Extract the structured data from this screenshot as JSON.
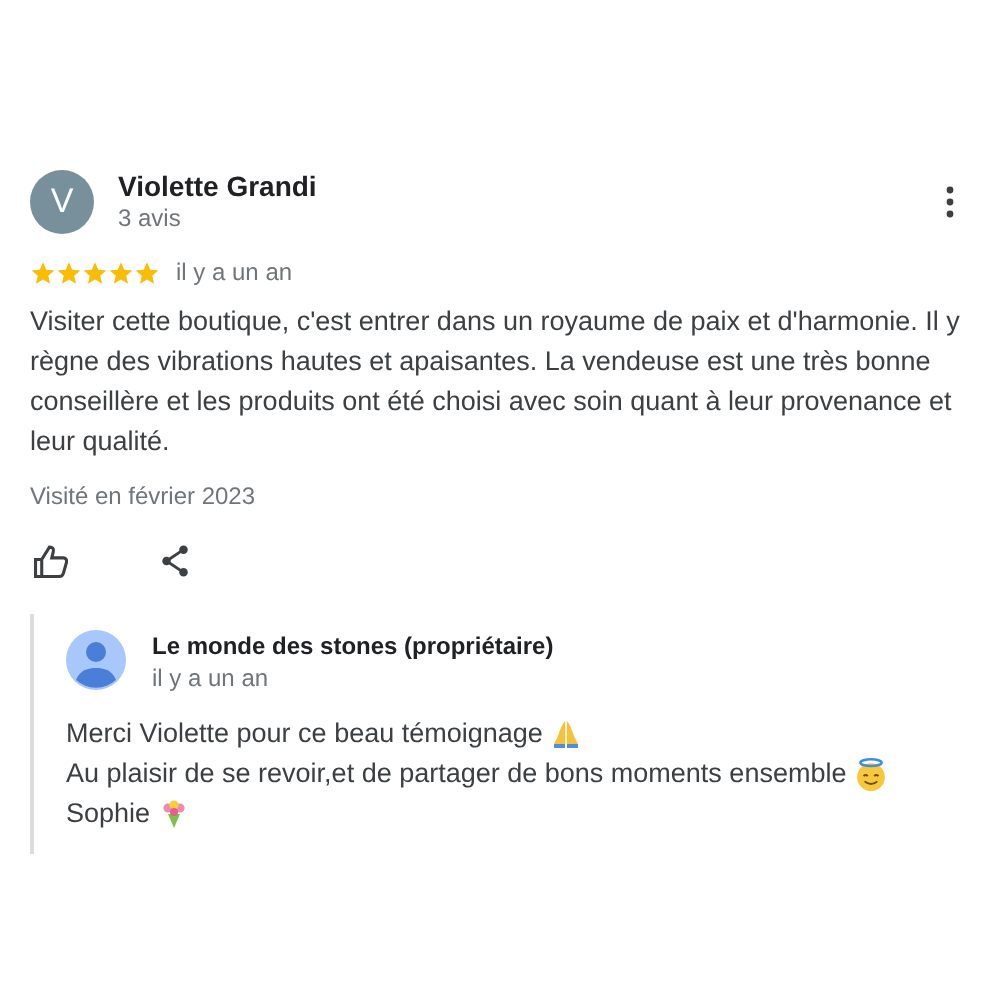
{
  "review": {
    "avatar_letter": "V",
    "author": "Violette Grandi",
    "meta": "3 avis",
    "stars": 5,
    "time": "il y a un an",
    "text": "Visiter cette boutique, c'est entrer dans un royaume de paix et d'harmonie. Il y règne des vibrations hautes et apaisantes. La vendeuse est une très bonne conseillère et les produits ont été choisi avec soin quant à leur provenance et leur qualité.",
    "visited": "Visité en février 2023"
  },
  "reply": {
    "author": "Le monde des stones (propriétaire)",
    "time": "il y a un an",
    "lines": [
      {
        "text": "Merci Violette pour ce beau témoignage",
        "kind": "pray"
      },
      {
        "text": "Au plaisir de se revoir,et de partager de bons moments ensemble",
        "kind": "halo"
      },
      {
        "text": "Sophie",
        "kind": "bouquet"
      }
    ]
  }
}
